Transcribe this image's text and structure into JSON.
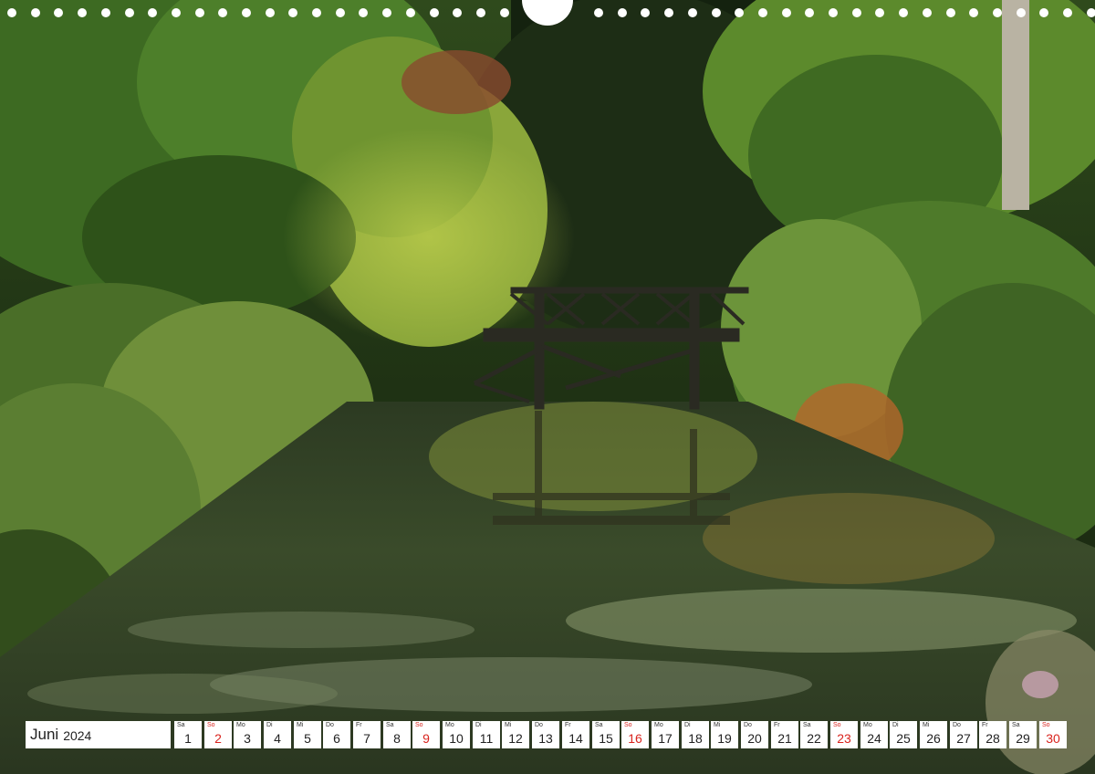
{
  "calendar": {
    "month": "Juni",
    "year": "2024",
    "sunday_color": "#d9241e",
    "days": [
      {
        "wd": "Sa",
        "num": "1"
      },
      {
        "wd": "So",
        "num": "2"
      },
      {
        "wd": "Mo",
        "num": "3"
      },
      {
        "wd": "Di",
        "num": "4"
      },
      {
        "wd": "Mi",
        "num": "5"
      },
      {
        "wd": "Do",
        "num": "6"
      },
      {
        "wd": "Fr",
        "num": "7"
      },
      {
        "wd": "Sa",
        "num": "8"
      },
      {
        "wd": "So",
        "num": "9"
      },
      {
        "wd": "Mo",
        "num": "10"
      },
      {
        "wd": "Di",
        "num": "11"
      },
      {
        "wd": "Mi",
        "num": "12"
      },
      {
        "wd": "Do",
        "num": "13"
      },
      {
        "wd": "Fr",
        "num": "14"
      },
      {
        "wd": "Sa",
        "num": "15"
      },
      {
        "wd": "So",
        "num": "16"
      },
      {
        "wd": "Mo",
        "num": "17"
      },
      {
        "wd": "Di",
        "num": "18"
      },
      {
        "wd": "Mi",
        "num": "19"
      },
      {
        "wd": "Do",
        "num": "20"
      },
      {
        "wd": "Fr",
        "num": "21"
      },
      {
        "wd": "Sa",
        "num": "22"
      },
      {
        "wd": "So",
        "num": "23"
      },
      {
        "wd": "Mo",
        "num": "24"
      },
      {
        "wd": "Di",
        "num": "25"
      },
      {
        "wd": "Mi",
        "num": "26"
      },
      {
        "wd": "Do",
        "num": "27"
      },
      {
        "wd": "Fr",
        "num": "28"
      },
      {
        "wd": "Sa",
        "num": "29"
      },
      {
        "wd": "So",
        "num": "30"
      }
    ]
  }
}
